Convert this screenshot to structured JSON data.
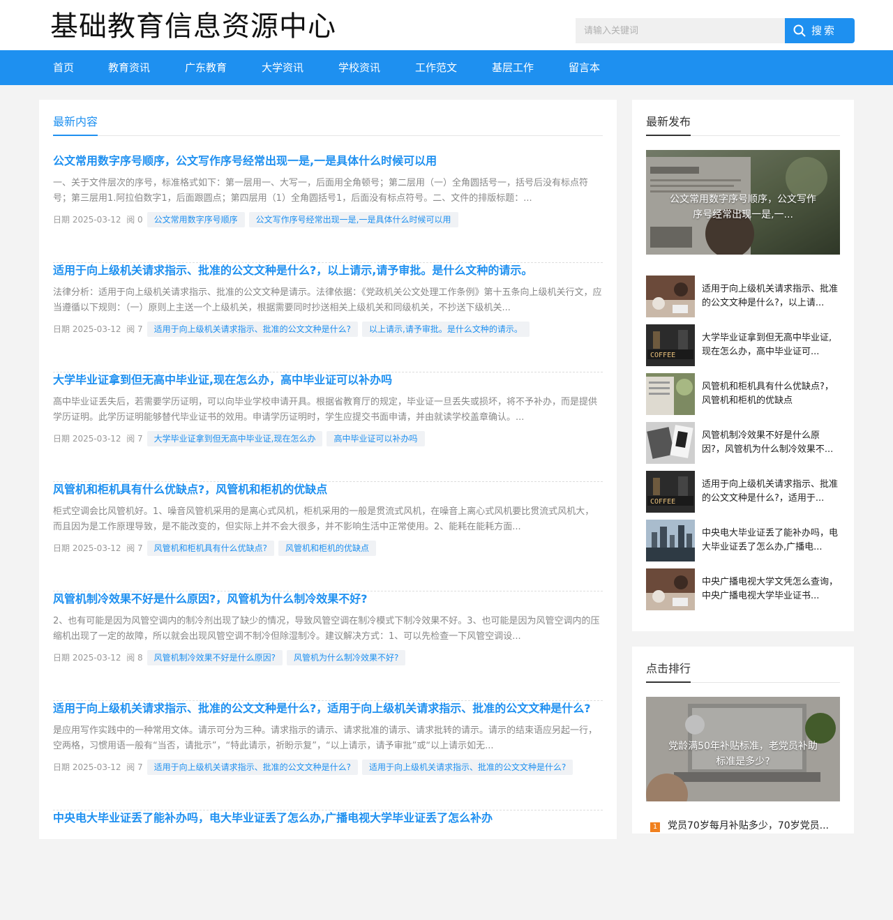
{
  "site_title": "基础教育信息资源中心",
  "search": {
    "placeholder": "请输入关键词",
    "button": "搜索"
  },
  "nav": [
    "首页",
    "教育资讯",
    "广东教育",
    "大学资讯",
    "学校资讯",
    "工作范文",
    "基层工作",
    "留言本"
  ],
  "main": {
    "heading": "最新内容",
    "posts": [
      {
        "title": "公文常用数字序号顺序，公文写作序号经常出现一是,一是具体什么时候可以用",
        "excerpt": "一、关于文件层次的序号，标准格式如下：第一层用一、大写一，后面用全角顿号；第二层用（一）全角圆括号一，括号后没有标点符号；第三层用1.阿拉伯数字1，后面跟圆点；第四层用（1）全角圆括号1，后面没有标点符号。二、文件的排版标题：...",
        "date": "日期 2025-03-12",
        "views": "阅 0",
        "tags": [
          "公文常用数字序号顺序",
          "公文写作序号经常出现一是,一是具体什么时候可以用"
        ]
      },
      {
        "title": "适用于向上级机关请求指示、批准的公文文种是什么?，以上请示,请予审批。是什么文种的请示。",
        "excerpt": "法律分析：适用于向上级机关请求指示、批准的公文文种是请示。法律依据：《党政机关公文处理工作条例》第十五条向上级机关行文，应当遵循以下规则：（一）原则上主送一个上级机关，根据需要同时抄送相关上级机关和同级机关，不抄送下级机关...",
        "date": "日期 2025-03-12",
        "views": "阅 7",
        "tags": [
          "适用于向上级机关请求指示、批准的公文文种是什么?",
          "以上请示,请予审批。是什么文种的请示。"
        ]
      },
      {
        "title": "大学毕业证拿到但无高中毕业证,现在怎么办，高中毕业证可以补办吗",
        "excerpt": "高中毕业证丢失后，若需要学历证明，可以向毕业学校申请开具。根据省教育厅的规定，毕业证一旦丢失或损坏，将不予补办，而是提供学历证明。此学历证明能够替代毕业证书的效用。申请学历证明时，学生应提交书面申请，并由就读学校盖章确认。...",
        "date": "日期 2025-03-12",
        "views": "阅 7",
        "tags": [
          "大学毕业证拿到但无高中毕业证,现在怎么办",
          "高中毕业证可以补办吗"
        ]
      },
      {
        "title": "风管机和柜机具有什么优缺点?，风管机和柜机的优缺点",
        "excerpt": "柜式空调会比风管机好。1、噪音风管机采用的是离心式风机，柜机采用的一般是贯流式风机，在噪音上离心式风机要比贯流式风机大，而且因为是工作原理导致，是不能改变的，但实际上并不会大很多，并不影响生活中正常使用。2、能耗在能耗方面...",
        "date": "日期 2025-03-12",
        "views": "阅 7",
        "tags": [
          "风管机和柜机具有什么优缺点?",
          "风管机和柜机的优缺点"
        ]
      },
      {
        "title": "风管机制冷效果不好是什么原因?，风管机为什么制冷效果不好?",
        "excerpt": "2、也有可能是因为风管空调内的制冷剂出现了缺少的情况，导致风管空调在制冷模式下制冷效果不好。3、也可能是因为风管空调内的压缩机出现了一定的故障，所以就会出现风管空调不制冷但除湿制冷。建议解决方式：1、可以先检查一下风管空调设...",
        "date": "日期 2025-03-12",
        "views": "阅 8",
        "tags": [
          "风管机制冷效果不好是什么原因?",
          "风管机为什么制冷效果不好?"
        ]
      },
      {
        "title": "适用于向上级机关请求指示、批准的公文文种是什么?，适用于向上级机关请求指示、批准的公文文种是什么?",
        "excerpt": "是应用写作实践中的一种常用文体。请示可分为三种。请求指示的请示、请求批准的请示、请求批转的请示。请示的结束语应另起一行，空两格，习惯用语一般有“当否，请批示”，“特此请示，祈盼示复”，“以上请示，请予审批”或“以上请示如无...",
        "date": "日期 2025-03-12",
        "views": "阅 7",
        "tags": [
          "适用于向上级机关请求指示、批准的公文文种是什么?",
          "适用于向上级机关请求指示、批准的公文文种是什么?"
        ]
      },
      {
        "title": "中央电大毕业证丢了能补办吗，电大毕业证丢了怎么办,广播电视大学毕业证丢了怎么补办",
        "excerpt": "",
        "date": "",
        "views": "",
        "tags": []
      }
    ]
  },
  "latest": {
    "heading": "最新发布",
    "featured": "公文常用数字序号顺序，公文写作序号经常出现一是,一...",
    "items": [
      {
        "text": "适用于向上级机关请求指示、批准的公文文种是什么?，以上请...",
        "thumb": "hands"
      },
      {
        "text": "大学毕业证拿到但无高中毕业证,现在怎么办，高中毕业证可...",
        "thumb": "coffee"
      },
      {
        "text": "风管机和柜机具有什么优缺点?，风管机和柜机的优缺点",
        "thumb": "newspaper"
      },
      {
        "text": "风管机制冷效果不好是什么原因?，风管机为什么制冷效果不...",
        "thumb": "desk"
      },
      {
        "text": "适用于向上级机关请求指示、批准的公文文种是什么?，适用于...",
        "thumb": "coffee"
      },
      {
        "text": "中央电大毕业证丢了能补办吗，电大毕业证丢了怎么办,广播电...",
        "thumb": "city"
      },
      {
        "text": "中央广播电视大学文凭怎么查询，中央广播电视大学毕业证书...",
        "thumb": "hands"
      }
    ]
  },
  "ranking": {
    "heading": "点击排行",
    "featured": "党龄满50年补贴标准，老党员补助标准是多少?",
    "items": [
      {
        "no": "1",
        "text": "党员70岁每月补贴多少，70岁党员..."
      }
    ]
  },
  "colors": {
    "accent": "#1e90f0",
    "rank_badge": "#f0801e"
  }
}
